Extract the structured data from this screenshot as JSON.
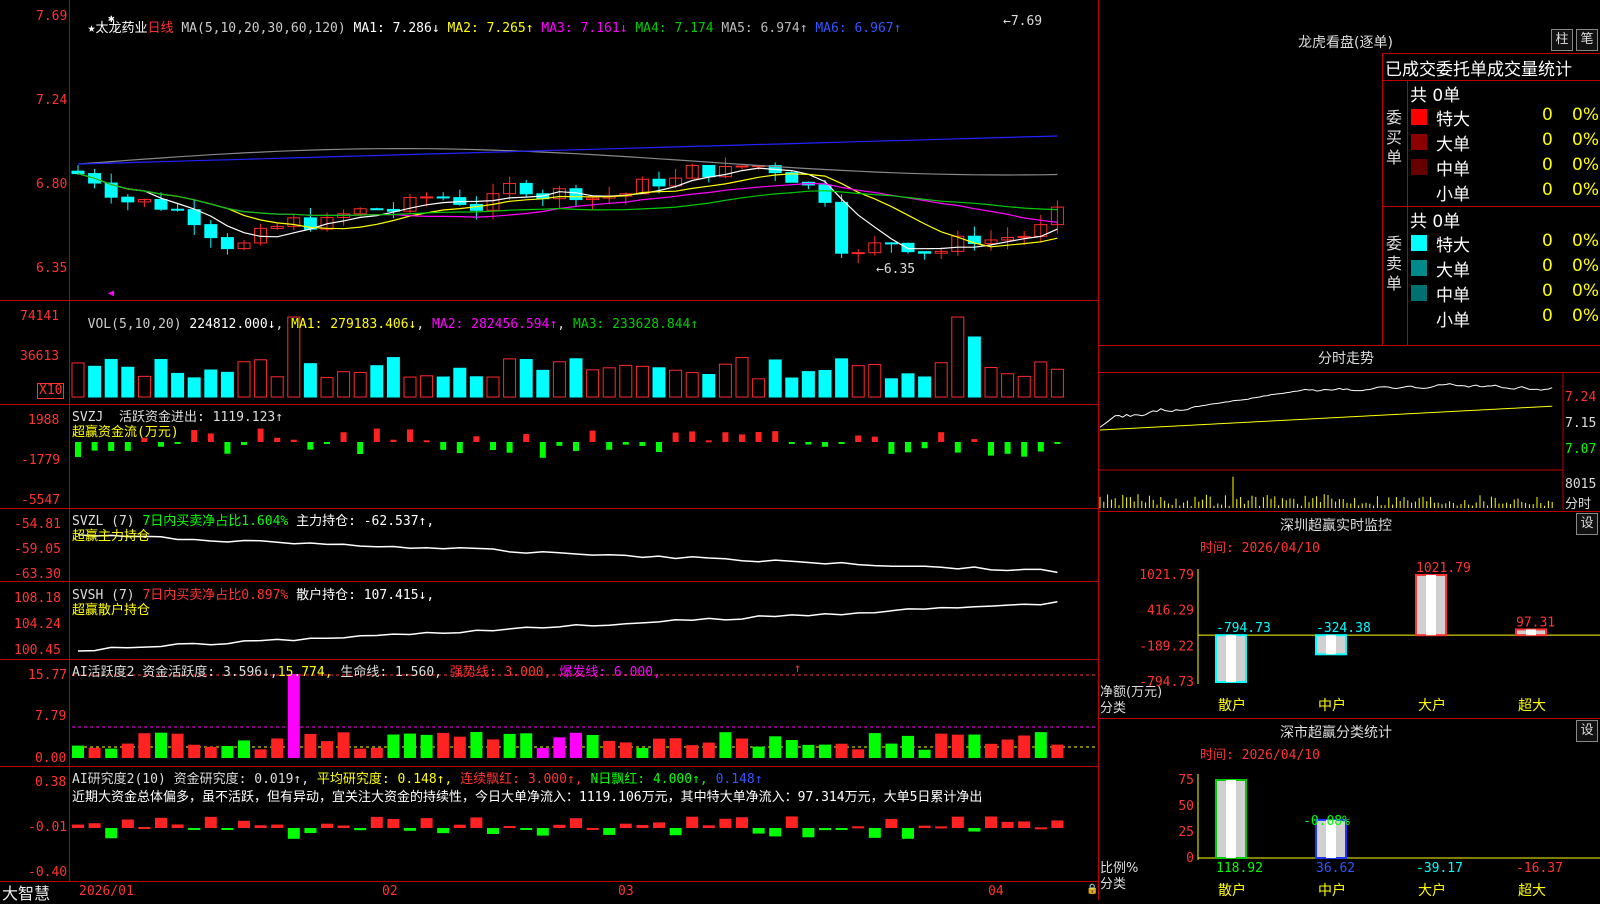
{
  "app": {
    "brand": "大智慧",
    "stock_name": "太龙药业",
    "period": "日线"
  },
  "colors": {
    "up": "#ff2a2a",
    "down": "#00ffff",
    "ma1": "#ffffff",
    "ma2": "#ffff00",
    "ma3": "#ff00ff",
    "ma4": "#00cc00",
    "ma5": "#888888",
    "ma6": "#2222ff",
    "axis": "#ff0000",
    "bg": "#000000"
  },
  "main_panel": {
    "ma_header": {
      "label": "MA(5,10,20,30,60,120)",
      "ma1": "MA1: 7.286↓",
      "ma2": "MA2: 7.265↑",
      "ma3": "MA3: 7.161↓",
      "ma4": "MA4: 7.174",
      "ma5": "MA5: 6.974↑",
      "ma6": "MA6: 6.967↑"
    },
    "y_ticks": [
      "7.69",
      "7.24",
      "6.80",
      "6.35"
    ],
    "high_label": "7.69",
    "low_label": "6.35"
  },
  "vol_panel": {
    "header": "VOL(5,10,20)",
    "value": "224812.000↓",
    "ma1": "MA1: 279183.406↓",
    "ma2": "MA2: 282456.594↑",
    "ma3": "MA3: 233628.844↑",
    "y_ticks": [
      "74141",
      "36613"
    ],
    "unit": "X10"
  },
  "svzj_panel": {
    "header": "SVZJ  活跃资金进出: 1119.123↑",
    "subtitle": "超赢资金流(万元)",
    "y_ticks": [
      "1988",
      "-1779",
      "-5547"
    ]
  },
  "svzl_panel": {
    "header_a": "SVZL (7)",
    "header_b": "7日内买卖净占比1.604%",
    "header_c": "主力持仓: -62.537↑,",
    "subtitle": "超赢主力持仓",
    "y_ticks": [
      "-54.81",
      "-59.05",
      "-63.30"
    ]
  },
  "svsh_panel": {
    "header_a": "SVSH (7)",
    "header_b": "7日内买卖净占比0.897%",
    "header_c": "散户持仓: 107.415↓,",
    "subtitle": "超赢散户持仓",
    "y_ticks": [
      "108.18",
      "104.24",
      "100.45"
    ]
  },
  "ai_hyd_panel": {
    "h1": "AI活跃度2 资金活跃度: 3.596↓,",
    "h2": "15.774,",
    "h3": "生命线: 1.560,",
    "h4": "强势线: 3.000,",
    "h5": "爆发线: 6.000,",
    "y_ticks": [
      "15.77",
      "7.79",
      "0.00"
    ]
  },
  "ai_yjd_panel": {
    "h1": "AI研究度2(10) 资金研究度: 0.019↑,",
    "h2": "平均研究度: 0.148↑,",
    "h3": "连续飘红: 3.000↑,",
    "h4": "N日飘红: 4.000↑,",
    "h5": "0.148↑",
    "commentary": "近期大资金总体偏多，虽不活跃，但有异动，宜关注大资金的持续性，今日大单净流入：1119.106万元，其中特大单净流入：97.314万元，大单5日累计净出",
    "y_ticks": [
      "0.38",
      "-0.01",
      "-0.40"
    ]
  },
  "x_axis": {
    "labels": [
      "2026/01",
      "02",
      "03",
      "04"
    ]
  },
  "right": {
    "lhkp": {
      "title": "龙虎看盘(逐单)",
      "btn1": "柱",
      "btn2": "笔",
      "stats_title": "已成交委托单成交量统计",
      "buy": {
        "group": "委买单",
        "total": "共 0单",
        "rows": [
          {
            "label": "特大",
            "count": "0",
            "pct": "0%",
            "color": "#ff0000"
          },
          {
            "label": "大单",
            "count": "0",
            "pct": "0%",
            "color": "#8b0000"
          },
          {
            "label": "中单",
            "count": "0",
            "pct": "0%",
            "color": "#660000"
          },
          {
            "label": "小单",
            "count": "0",
            "pct": "0%",
            "color": ""
          }
        ]
      },
      "sell": {
        "group": "委卖单",
        "total": "共 0单",
        "rows": [
          {
            "label": "特大",
            "count": "0",
            "pct": "0%",
            "color": "#00ffff"
          },
          {
            "label": "大单",
            "count": "0",
            "pct": "0%",
            "color": "#008b8b"
          },
          {
            "label": "中单",
            "count": "0",
            "pct": "0%",
            "color": "#007070"
          },
          {
            "label": "小单",
            "count": "0",
            "pct": "0%",
            "color": ""
          }
        ]
      }
    },
    "fszs": {
      "title": "分时走势",
      "y_ticks": [
        "7.24",
        "7.15",
        "7.07"
      ],
      "vol_label": "8015",
      "vol_unit": "分时"
    },
    "szcy": {
      "title": "深圳超赢实时监控",
      "btn": "设",
      "time": "时间: 2026/04/10",
      "y_ticks": [
        "1021.79",
        "416.29",
        "-189.22",
        "-794.73"
      ],
      "ylabel_a": "净额(万元)",
      "ylabel_b": "分类",
      "chart_data": {
        "type": "bar",
        "categories": [
          "散户",
          "中户",
          "大户",
          "超大"
        ],
        "values": [
          -794.73,
          -324.38,
          1021.79,
          97.31
        ],
        "value_labels": [
          "-794.73",
          "-324.38",
          "1021.79",
          "97.31"
        ],
        "ylim": [
          -794.73,
          1021.79
        ]
      }
    },
    "sscy": {
      "title": "深市超赢分类统计",
      "btn": "设",
      "time": "时间: 2026/04/10",
      "y_ticks": [
        "75",
        "50",
        "25",
        "0"
      ],
      "ylabel_a": "比例%",
      "ylabel_b": "分类",
      "pct_label": "-0.08%",
      "chart_data": {
        "type": "bar",
        "categories": [
          "散户",
          "中户",
          "大户",
          "超大"
        ],
        "values": [
          118.92,
          36.62,
          -39.17,
          -16.37
        ],
        "value_labels": [
          "118.92",
          "36.62",
          "-39.17",
          "-16.37"
        ],
        "ylim": [
          0,
          75
        ]
      }
    }
  }
}
